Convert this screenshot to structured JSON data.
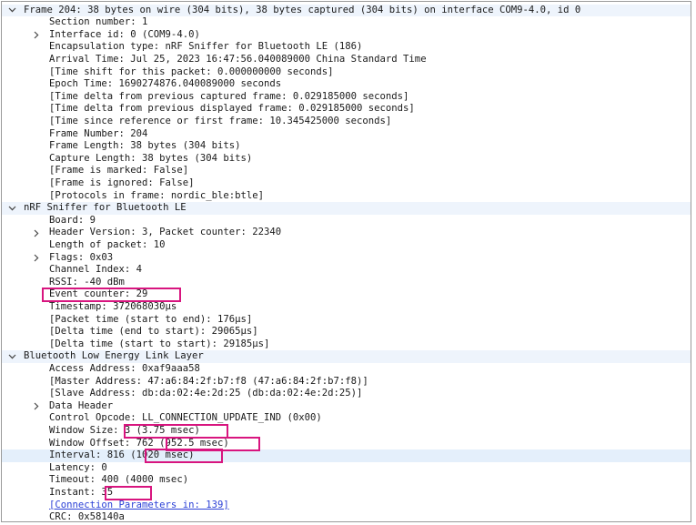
{
  "rows": [
    {
      "text": "Frame 204: 38 bytes on wire (304 bits), 38 bytes captured (304 bits) on interface COM9-4.0, id 0",
      "level": 0,
      "toggle": "expanded"
    },
    {
      "text": "Section number: 1",
      "level": 1,
      "toggle": "none"
    },
    {
      "text": "Interface id: 0 (COM9-4.0)",
      "level": 1,
      "toggle": "collapsed"
    },
    {
      "text": "Encapsulation type: nRF Sniffer for Bluetooth LE (186)",
      "level": 1,
      "toggle": "none"
    },
    {
      "text": "Arrival Time: Jul 25, 2023 16:47:56.040089000 China Standard Time",
      "level": 1,
      "toggle": "none"
    },
    {
      "text": "[Time shift for this packet: 0.000000000 seconds]",
      "level": 1,
      "toggle": "none"
    },
    {
      "text": "Epoch Time: 1690274876.040089000 seconds",
      "level": 1,
      "toggle": "none"
    },
    {
      "text": "[Time delta from previous captured frame: 0.029185000 seconds]",
      "level": 1,
      "toggle": "none"
    },
    {
      "text": "[Time delta from previous displayed frame: 0.029185000 seconds]",
      "level": 1,
      "toggle": "none"
    },
    {
      "text": "[Time since reference or first frame: 10.345425000 seconds]",
      "level": 1,
      "toggle": "none"
    },
    {
      "text": "Frame Number: 204",
      "level": 1,
      "toggle": "none"
    },
    {
      "text": "Frame Length: 38 bytes (304 bits)",
      "level": 1,
      "toggle": "none"
    },
    {
      "text": "Capture Length: 38 bytes (304 bits)",
      "level": 1,
      "toggle": "none"
    },
    {
      "text": "[Frame is marked: False]",
      "level": 1,
      "toggle": "none"
    },
    {
      "text": "[Frame is ignored: False]",
      "level": 1,
      "toggle": "none"
    },
    {
      "text": "[Protocols in frame: nordic_ble:btle]",
      "level": 1,
      "toggle": "none"
    },
    {
      "text": "nRF Sniffer for Bluetooth LE",
      "level": 0,
      "toggle": "expanded"
    },
    {
      "text": "Board: 9",
      "level": 1,
      "toggle": "none"
    },
    {
      "text": "Header Version: 3, Packet counter: 22340",
      "level": 1,
      "toggle": "collapsed"
    },
    {
      "text": "Length of packet: 10",
      "level": 1,
      "toggle": "none"
    },
    {
      "text": "Flags: 0x03",
      "level": 1,
      "toggle": "collapsed"
    },
    {
      "text": "Channel Index: 4",
      "level": 1,
      "toggle": "none"
    },
    {
      "text": "RSSI: -40 dBm",
      "level": 1,
      "toggle": "none"
    },
    {
      "text": "Event counter: 29",
      "level": 1,
      "toggle": "none"
    },
    {
      "text": "Timestamp: 372068030µs",
      "level": 1,
      "toggle": "none"
    },
    {
      "text": "[Packet time (start to end): 176µs]",
      "level": 1,
      "toggle": "none"
    },
    {
      "text": "[Delta time (end to start): 29065µs]",
      "level": 1,
      "toggle": "none"
    },
    {
      "text": "[Delta time (start to start): 29185µs]",
      "level": 1,
      "toggle": "none"
    },
    {
      "text": "Bluetooth Low Energy Link Layer",
      "level": 0,
      "toggle": "expanded"
    },
    {
      "text": "Access Address: 0xaf9aaa58",
      "level": 1,
      "toggle": "none"
    },
    {
      "text": "[Master Address: 47:a6:84:2f:b7:f8 (47:a6:84:2f:b7:f8)]",
      "level": 1,
      "toggle": "none"
    },
    {
      "text": "[Slave Address: db:da:02:4e:2d:25 (db:da:02:4e:2d:25)]",
      "level": 1,
      "toggle": "none"
    },
    {
      "text": "Data Header",
      "level": 1,
      "toggle": "collapsed"
    },
    {
      "text": "Control Opcode: LL_CONNECTION_UPDATE_IND (0x00)",
      "level": 1,
      "toggle": "none"
    },
    {
      "text": "Window Size: 3 (3.75 msec)",
      "level": 1,
      "toggle": "none"
    },
    {
      "text": "Window Offset: 762 (952.5 msec)",
      "level": 1,
      "toggle": "none"
    },
    {
      "text": "Interval: 816 (1020 msec)",
      "level": 1,
      "toggle": "none",
      "highlight": true
    },
    {
      "text": "Latency: 0",
      "level": 1,
      "toggle": "none"
    },
    {
      "text": "Timeout: 400 (4000 msec)",
      "level": 1,
      "toggle": "none"
    },
    {
      "text": "Instant: 35",
      "level": 1,
      "toggle": "none"
    },
    {
      "text": "[Connection Parameters in: 139]",
      "level": 1,
      "toggle": "none",
      "link": true
    },
    {
      "text": "CRC: 0x58140a",
      "level": 1,
      "toggle": "none"
    }
  ],
  "annotation_color": "#d8157f",
  "link_color": "#2a3fd6",
  "highlight_color": "#e4effb",
  "header_band_color": "#eef4fc"
}
